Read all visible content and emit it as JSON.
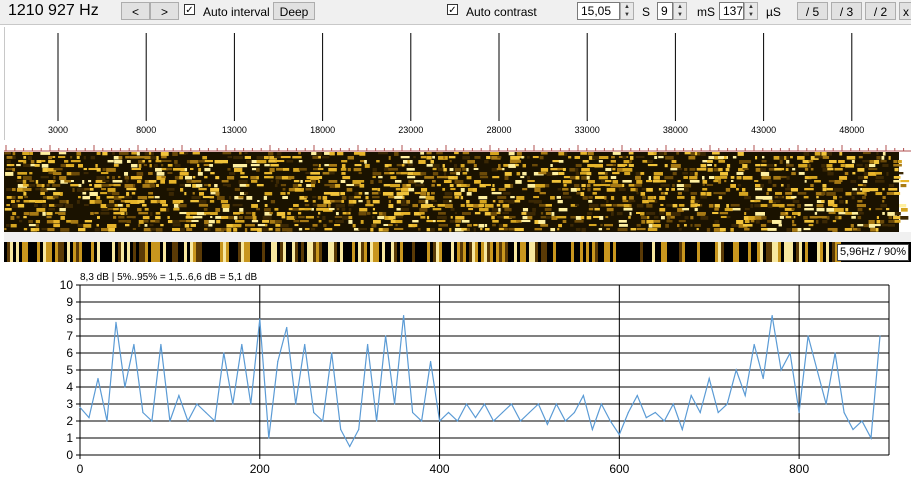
{
  "toolbar": {
    "frequency": "1210 927 Hz",
    "prev_label": "<",
    "next_label": ">",
    "auto_interval_label": "Auto interval",
    "deep_label": "Deep",
    "auto_contrast_label": "Auto contrast",
    "seconds_value": "15,05",
    "seconds_unit": "S",
    "ms_value": "9",
    "ms_unit": "mS",
    "us_value": "137",
    "us_unit": "µS",
    "div5_label": "/ 5",
    "div3_label": "/ 3",
    "div2_label": "/ 2",
    "close_label": "x"
  },
  "scale": {
    "ticks": [
      "3000",
      "8000",
      "13000",
      "18000",
      "23000",
      "28000",
      "33000",
      "38000",
      "43000",
      "48000"
    ]
  },
  "spectrum": {
    "readout": "5,96Hz / 90%"
  },
  "chart_data": {
    "type": "line",
    "title": "8,3 dB | 5%..95% = 1,5..6,6 dB = 5,1 dB",
    "xlim": [
      0,
      900
    ],
    "ylim": [
      0,
      10
    ],
    "xticks": [
      "0",
      "200",
      "400",
      "600",
      "800"
    ],
    "yticks": [
      "0",
      "1",
      "2",
      "3",
      "4",
      "5",
      "6",
      "7",
      "8",
      "9",
      "10"
    ],
    "grid": true,
    "color": "#5b9bd5",
    "series": [
      {
        "x": [
          0,
          10,
          20,
          30,
          40,
          50,
          60,
          70,
          80,
          90,
          100,
          110,
          120,
          130,
          140,
          150,
          160,
          170,
          180,
          190,
          200,
          210,
          220,
          230,
          240,
          250,
          260,
          270,
          280,
          290,
          300,
          310,
          320,
          330,
          340,
          350,
          360,
          370,
          380,
          390,
          400,
          410,
          420,
          430,
          440,
          450,
          460,
          470,
          480,
          490,
          500,
          510,
          520,
          530,
          540,
          550,
          560,
          570,
          580,
          590,
          600,
          610,
          620,
          630,
          640,
          650,
          660,
          670,
          680,
          690,
          700,
          710,
          720,
          730,
          740,
          750,
          760,
          770,
          780,
          790,
          800,
          810,
          820,
          830,
          840,
          850,
          860,
          870,
          880,
          890
        ],
        "y": [
          2.8,
          2.2,
          4.5,
          2.0,
          7.8,
          4.0,
          6.5,
          2.5,
          2.0,
          6.5,
          2.0,
          3.5,
          2.0,
          3.0,
          2.5,
          2.0,
          6.0,
          3.0,
          6.5,
          3.0,
          8.0,
          1.0,
          5.5,
          7.5,
          3.0,
          6.5,
          2.5,
          2.0,
          6.0,
          1.5,
          0.5,
          1.5,
          6.5,
          2.0,
          7.0,
          3.0,
          8.2,
          2.5,
          2.0,
          5.5,
          2.0,
          2.5,
          2.0,
          3.0,
          2.2,
          3.0,
          2.0,
          2.5,
          3.0,
          2.0,
          2.5,
          3.0,
          1.8,
          3.0,
          2.0,
          2.5,
          3.5,
          1.5,
          3.0,
          2.0,
          1.2,
          2.5,
          3.5,
          2.2,
          2.5,
          2.0,
          3.0,
          1.5,
          3.5,
          2.5,
          4.5,
          2.5,
          3.0,
          5.0,
          3.5,
          6.5,
          4.5,
          8.2,
          5.0,
          6.0,
          2.5,
          7.0,
          5.0,
          3.0,
          6.0,
          2.5,
          1.5,
          2.0,
          1.0,
          7.0
        ]
      }
    ]
  }
}
